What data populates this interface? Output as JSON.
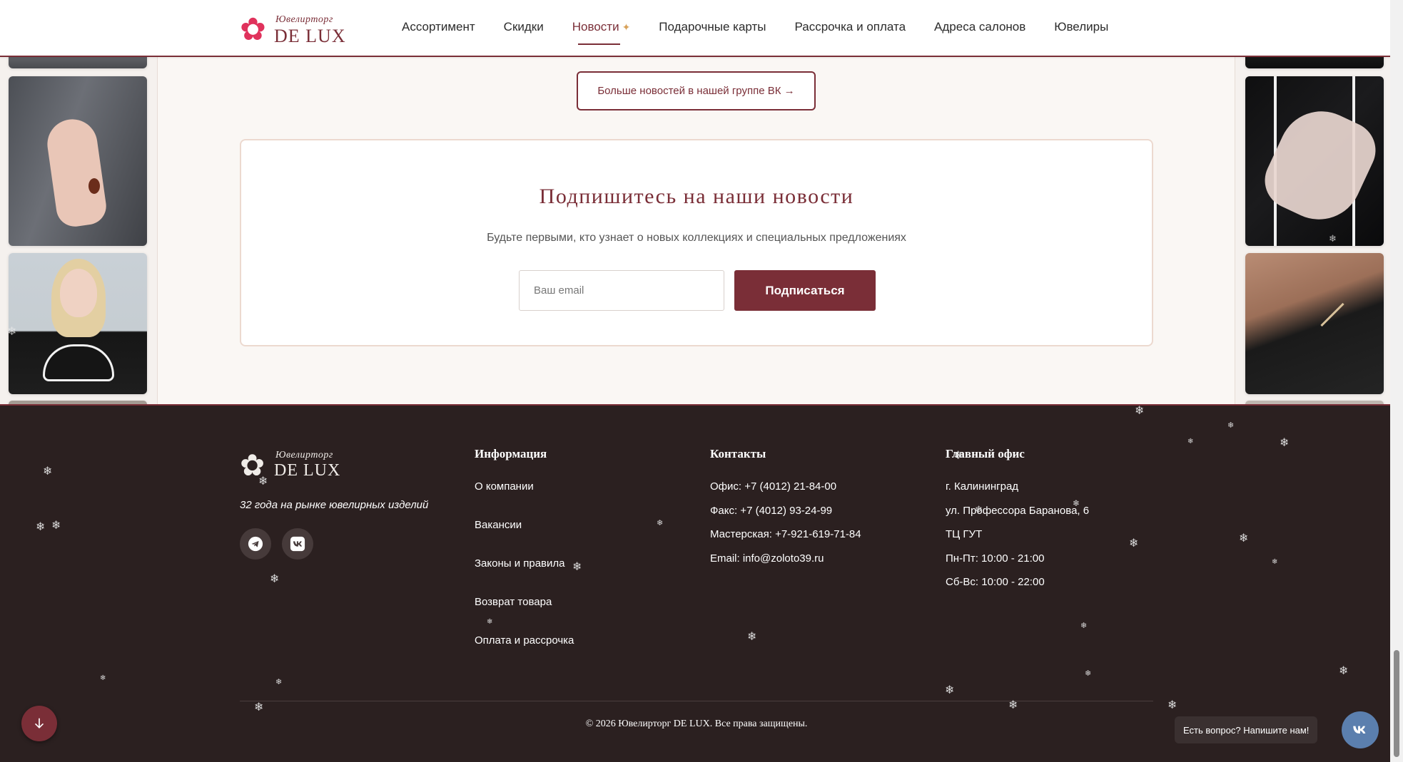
{
  "header": {
    "logo_script": "Ювелирторг",
    "logo_main": "DE LUX",
    "nav": [
      {
        "label": "Ассортимент"
      },
      {
        "label": "Скидки"
      },
      {
        "label": "Новости",
        "active": true
      },
      {
        "label": "Подарочные карты"
      },
      {
        "label": "Рассрочка и оплата"
      },
      {
        "label": "Адреса салонов"
      },
      {
        "label": "Ювелиры"
      }
    ]
  },
  "news": {
    "vk_button": "Больше новостей в нашей группе ВК →"
  },
  "subscribe": {
    "title": "Подпишитесь на наши новости",
    "text": "Будьте первыми, кто узнает о новых коллекциях и специальных предложениях",
    "email_placeholder": "Ваш email",
    "button": "Подписаться"
  },
  "footer": {
    "logo_script": "Ювелирторг",
    "logo_main": "DE LUX",
    "tagline": "32 года на рынке ювелирных изделий",
    "info_title": "Информация",
    "info_links": [
      "О компании",
      "Вакансии",
      "Законы и правила",
      "Возврат товара",
      "Оплата и рассрочка"
    ],
    "contacts_title": "Контакты",
    "contacts": [
      "Офис: +7 (4012) 21-84-00",
      "Факс: +7 (4012) 93-24-99",
      "Мастерская: +7-921-619-71-84",
      "Email: info@zoloto39.ru"
    ],
    "office_title": "Главный офис",
    "office": [
      "г. Калининград",
      "ул. Профессора Баранова, 6",
      "ТЦ ГУТ",
      "Пн-Пт: 10:00 - 21:00",
      "Сб-Вс: 10:00 - 22:00"
    ],
    "copyright": "© 2026 Ювелирторг DE LUX. Все права защищены."
  },
  "widgets": {
    "chat_text": "Есть вопрос? Напишите нам!"
  },
  "icons": {
    "nav_spark": "✦",
    "telegram": "telegram-icon",
    "vk": "vk-icon",
    "arrow_down": "arrow-down-icon"
  },
  "colors": {
    "brand": "#7a2e37",
    "footer_bg": "#2b2020",
    "accent_spark": "#d8a25a",
    "vk_blue": "#5b7fae"
  }
}
